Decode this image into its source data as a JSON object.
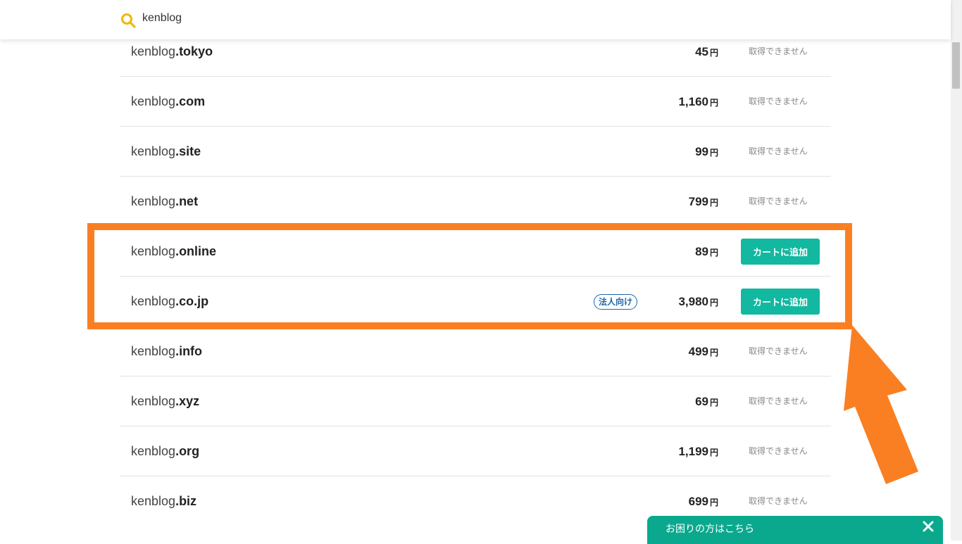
{
  "search": {
    "query": "kenblog"
  },
  "domains": [
    {
      "name": "kenblog",
      "tld": ".tokyo",
      "price": "45",
      "yen": "円",
      "status": "取得できません"
    },
    {
      "name": "kenblog",
      "tld": ".com",
      "price": "1,160",
      "yen": "円",
      "status": "取得できません"
    },
    {
      "name": "kenblog",
      "tld": ".site",
      "price": "99",
      "yen": "円",
      "status": "取得できません"
    },
    {
      "name": "kenblog",
      "tld": ".net",
      "price": "799",
      "yen": "円",
      "status": "取得できません"
    },
    {
      "name": "kenblog",
      "tld": ".online",
      "price": "89",
      "yen": "円",
      "button": "カートに追加"
    },
    {
      "name": "kenblog",
      "tld": ".co.jp",
      "price": "3,980",
      "yen": "円",
      "badge": "法人向け",
      "button": "カートに追加"
    },
    {
      "name": "kenblog",
      "tld": ".info",
      "price": "499",
      "yen": "円",
      "status": "取得できません"
    },
    {
      "name": "kenblog",
      "tld": ".xyz",
      "price": "69",
      "yen": "円",
      "status": "取得できません"
    },
    {
      "name": "kenblog",
      "tld": ".org",
      "price": "1,199",
      "yen": "円",
      "status": "取得できません"
    },
    {
      "name": "kenblog",
      "tld": ".biz",
      "price": "699",
      "yen": "円",
      "status": "取得できません"
    }
  ],
  "help": {
    "label": "お困りの方はこちら"
  },
  "colors": {
    "accent": "#12b8a0",
    "highlight": "#fa7f23",
    "help_bar": "#0aa98e",
    "badge": "#1e66a8",
    "search_icon": "#f2b705"
  },
  "icons": {
    "search": "search-icon",
    "close": "close-icon",
    "arrow": "arrow-up-left-annotation"
  }
}
